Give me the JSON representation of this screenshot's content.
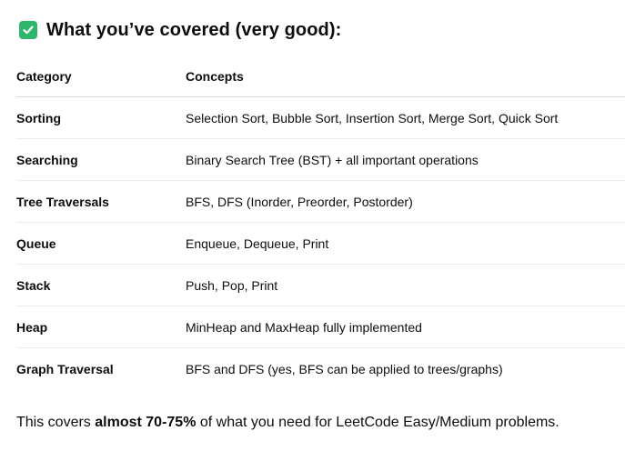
{
  "heading": {
    "icon": "check-box-icon",
    "icon_color": "#2fb66a",
    "text": "What you’ve covered (very good):"
  },
  "table": {
    "columns": [
      "Category",
      "Concepts"
    ],
    "rows": [
      {
        "category": "Sorting",
        "concepts": "Selection Sort, Bubble Sort, Insertion Sort, Merge Sort, Quick Sort"
      },
      {
        "category": "Searching",
        "concepts": "Binary Search Tree (BST) + all important operations"
      },
      {
        "category": "Tree Traversals",
        "concepts": "BFS, DFS (Inorder, Preorder, Postorder)"
      },
      {
        "category": "Queue",
        "concepts": "Enqueue, Dequeue, Print"
      },
      {
        "category": "Stack",
        "concepts": "Push, Pop, Print"
      },
      {
        "category": "Heap",
        "concepts": "MinHeap and MaxHeap fully implemented"
      },
      {
        "category": "Graph Traversal",
        "concepts": "BFS and DFS (yes, BFS can be applied to trees/graphs)"
      }
    ]
  },
  "summary": {
    "prefix": "This covers ",
    "emphasis": "almost 70-75%",
    "suffix": " of what you need for LeetCode Easy/Medium problems."
  }
}
